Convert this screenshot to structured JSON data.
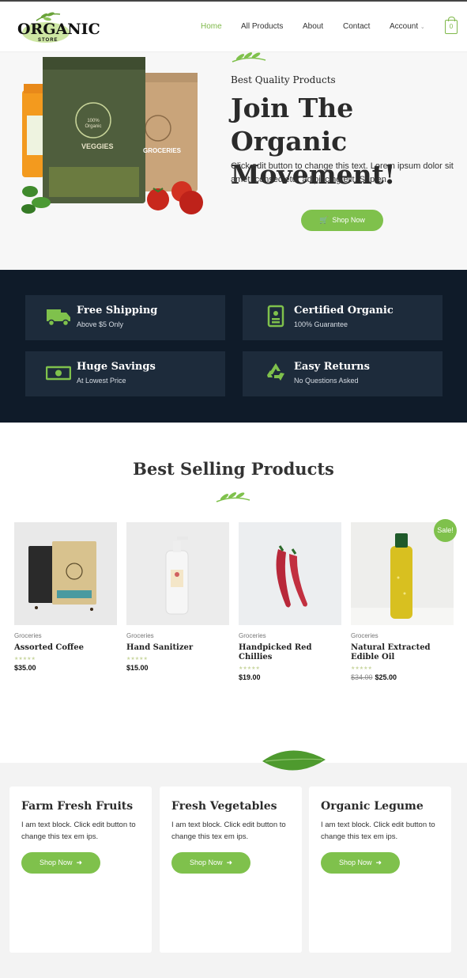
{
  "header": {
    "logo_text": "ORGANIC",
    "logo_sub": "STORE",
    "nav": [
      "Home",
      "All Products",
      "About",
      "Contact",
      "Account"
    ],
    "account_caret": "⌄",
    "cart_count": "0"
  },
  "hero": {
    "subtitle": "Best Quality Products",
    "title_line1": "Join The Organic",
    "title_line2": "Movement!",
    "text": "Click edit button to change this text. Lorem ipsum dolor sit amet, consectetur adipiscing elit. Sapien.",
    "button": "Shop Now",
    "bag_label_left": "VEGGIES",
    "bag_label_right": "GROCERIES",
    "seal_text": "100% Organic"
  },
  "features": [
    {
      "title": "Free Shipping",
      "sub": "Above $5 Only",
      "icon": "truck-icon"
    },
    {
      "title": "Certified Organic",
      "sub": "100% Guarantee",
      "icon": "certificate-icon"
    },
    {
      "title": "Huge Savings",
      "sub": "At Lowest Price",
      "icon": "money-icon"
    },
    {
      "title": "Easy Returns",
      "sub": "No Questions Asked",
      "icon": "recycle-icon"
    }
  ],
  "best_selling": {
    "title": "Best Selling Products",
    "sale_badge": "Sale!",
    "products": [
      {
        "category": "Groceries",
        "name": "Assorted Coffee",
        "price": "$35.00",
        "old_price": ""
      },
      {
        "category": "Groceries",
        "name": "Hand Sanitizer",
        "price": "$15.00",
        "old_price": ""
      },
      {
        "category": "Groceries",
        "name": "Handpicked Red Chillies",
        "price": "$19.00",
        "old_price": ""
      },
      {
        "category": "Groceries",
        "name": "Natural Extracted Edible Oil",
        "price": "$25.00",
        "old_price": "$34.00"
      }
    ],
    "stars": "★★★★★"
  },
  "categories": [
    {
      "title": "Farm Fresh Fruits",
      "text": "I am text block. Click edit button to change this tex em ips.",
      "button": "Shop Now"
    },
    {
      "title": "Fresh Vegetables",
      "text": "I am text block. Click edit button to change this tex em ips.",
      "button": "Shop Now"
    },
    {
      "title": "Organic Legume",
      "text": "I am text block. Click edit button to change this tex em ips.",
      "button": "Shop Now"
    }
  ],
  "colors": {
    "accent": "#7fc14c",
    "dark": "#0f1b29",
    "card_dark": "#1d2b3b"
  }
}
